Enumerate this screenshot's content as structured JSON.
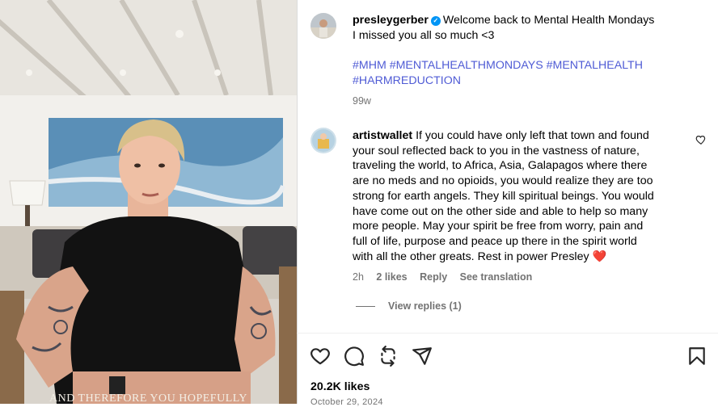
{
  "media": {
    "caption_overlay": "AND THEREFORE YOU HOPEFULLY"
  },
  "post": {
    "username": "presleygerber",
    "verified": true,
    "caption_line1": "Welcome back to Mental Health Mondays",
    "caption_line2": "I missed you all so much <3",
    "hashtags_line1": "#MHM #MENTALHEALTHMONDAYS #MENTALHEALTH",
    "hashtags_line2": "#HARMREDUCTION",
    "age": "99w"
  },
  "comment": {
    "username": "artistwallet",
    "text_lines": [
      "If you could have only left that town and found",
      "your soul reflected back to you in the vastness of nature,",
      "traveling the world, to Africa, Asia, Galapagos where there",
      "are no meds and no opioids, you would realize they are too",
      "strong for earth angels. They kill spiritual beings. You would",
      "have come out on the other side and able to help so many",
      "more people. May your spirit be free from worry, pain and",
      "full of life, purpose and peace up there in the spirit world",
      "with all the other greats. Rest in power Presley ❤️"
    ],
    "age": "2h",
    "likes": "2 likes",
    "reply_label": "Reply",
    "translate_label": "See translation",
    "view_replies": "View replies (1)"
  },
  "footer": {
    "likes": "20.2K likes",
    "date": "October 29, 2024"
  },
  "icons": {
    "like": "heart-icon",
    "comment": "comment-icon",
    "share": "repost-icon",
    "send": "send-icon",
    "save": "bookmark-icon"
  },
  "colors": {
    "hashtag": "#4f5bd5",
    "verified": "#0095f6",
    "muted": "#737373"
  }
}
